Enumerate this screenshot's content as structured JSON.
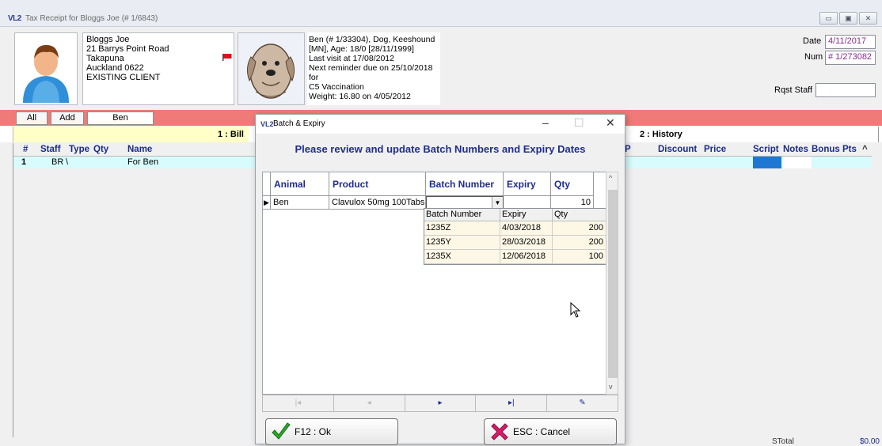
{
  "window": {
    "app_icon": "VL2",
    "title": "Tax Receipt for Bloggs Joe (# 1/6843)",
    "controls": [
      "minimize-icon",
      "maximize-icon",
      "close-icon"
    ]
  },
  "client": {
    "name": "Bloggs Joe",
    "address1": "21 Barrys Point Road",
    "address2": "Takapuna",
    "address3": "Auckland 0622",
    "status": "EXISTING CLIENT"
  },
  "pet": {
    "line1": "Ben (# 1/33304), Dog, Keeshound",
    "line2": "[MN], Age: 18/0  [28/11/1999]",
    "line3": "Last visit at 17/08/2012",
    "line4": "Next reminder due on 25/10/2018 for",
    "line5": "C5 Vaccination",
    "line6": "Weight: 16.80 on 4/05/2012"
  },
  "receipt": {
    "date_label": "Date",
    "date_value": "4/11/2017",
    "num_label": "Num",
    "num_value": "# 1/273082",
    "rqst_staff_label": "Rqst Staff",
    "rqst_staff_value": ""
  },
  "toolbar": {
    "all_label": "All",
    "add_label": "Add",
    "ben_label": "Ben"
  },
  "tabs": {
    "bill": "1 : Bill",
    "history": "2 : History"
  },
  "grid": {
    "headers": {
      "hash": "#",
      "staff": "Staff",
      "type": "Type",
      "qty": "Qty",
      "name": "Name",
      "p": "P",
      "discount": "Discount",
      "price": "Price",
      "script": "Script",
      "notes": "Notes",
      "bonus": "Bonus Pts"
    },
    "rows": [
      {
        "num": "1",
        "staff": "BR",
        "type": "\\",
        "qty": "",
        "name": "For Ben"
      }
    ],
    "stotal_label": "STotal",
    "stotal_value": "$0.00"
  },
  "dialog": {
    "app_icon": "VL2",
    "title": "Batch & Expiry",
    "heading": "Please review and update Batch Numbers and Expiry Dates",
    "columns": {
      "animal": "Animal",
      "product": "Product",
      "batch": "Batch Number",
      "expiry": "Expiry",
      "qty": "Qty"
    },
    "row": {
      "animal": "Ben",
      "product": "Clavulox 50mg 100Tabs",
      "batch": "",
      "expiry": "",
      "qty": "10"
    },
    "dropdown": {
      "headers": {
        "batch": "Batch Number",
        "expiry": "Expiry",
        "qty": "Qty"
      },
      "rows": [
        {
          "batch": "1235Z",
          "expiry": "4/03/2018",
          "qty": "200"
        },
        {
          "batch": "1235Y",
          "expiry": "28/03/2018",
          "qty": "200"
        },
        {
          "batch": "1235X",
          "expiry": "12/06/2018",
          "qty": "100"
        }
      ]
    },
    "ok_label": "F12 : Ok",
    "cancel_label": "ESC : Cancel"
  },
  "colors": {
    "pink_bar": "#f07a78",
    "heading_blue": "#1f2c8f",
    "bill_tab": "#ffffc7",
    "row_highlight": "#d8fbfd",
    "script_cell": "#1e78d2"
  }
}
